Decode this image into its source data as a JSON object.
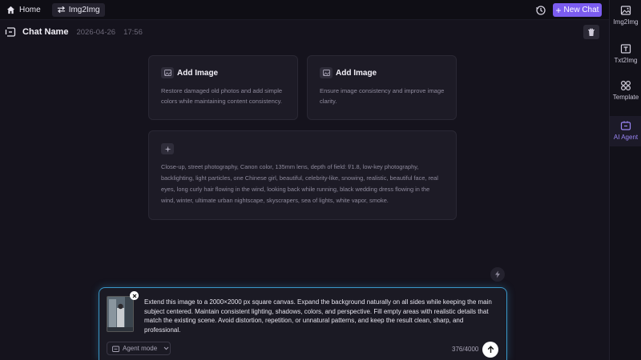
{
  "topbar": {
    "home_label": "Home",
    "tab_label": "Img2Img",
    "new_chat_label": "New Chat"
  },
  "sidebar": {
    "items": [
      {
        "label": "Img2Img",
        "icon": "image-icon"
      },
      {
        "label": "Txt2Img",
        "icon": "text-image-icon"
      },
      {
        "label": "Template",
        "icon": "template-icon"
      },
      {
        "label": "AI Agent",
        "icon": "ai-agent-icon",
        "active": true
      }
    ]
  },
  "chat": {
    "title": "Chat Name",
    "date": "2026-04-26",
    "time": "17:56"
  },
  "cards": [
    {
      "title": "Add Image",
      "desc": "Restore damaged old photos and add simple colors while maintaining content consistency."
    },
    {
      "title": "Add Image",
      "desc": "Ensure image consistency and improve image clarity."
    }
  ],
  "prompt_card": {
    "text": "Close-up, street photography, Canon color, 135mm lens, depth of field: f/1.8, low-key photography, backlighting, light particles, one Chinese girl, beautiful, celebrity-like, snowing, realistic, beautiful face, real eyes, long curly hair flowing in the wind, looking back while running, black wedding dress flowing in the wind, winter, ultimate urban nightscape, skyscrapers, sea of lights, white vapor, smoke."
  },
  "input": {
    "text": "Extend this image to a 2000×2000 px square canvas. Expand the background naturally on all sides while keeping the main subject centered. Maintain consistent lighting, shadows, colors, and perspective. Fill empty areas with realistic details that match the existing scene. Avoid distortion, repetition, or unnatural patterns, and keep the result clean, sharp, and professional.",
    "mode_label": "Agent mode",
    "counter": "376/4000"
  },
  "colors": {
    "accent": "#7b5cf0",
    "focus_border": "#3a97c8",
    "background": "#15131d"
  }
}
